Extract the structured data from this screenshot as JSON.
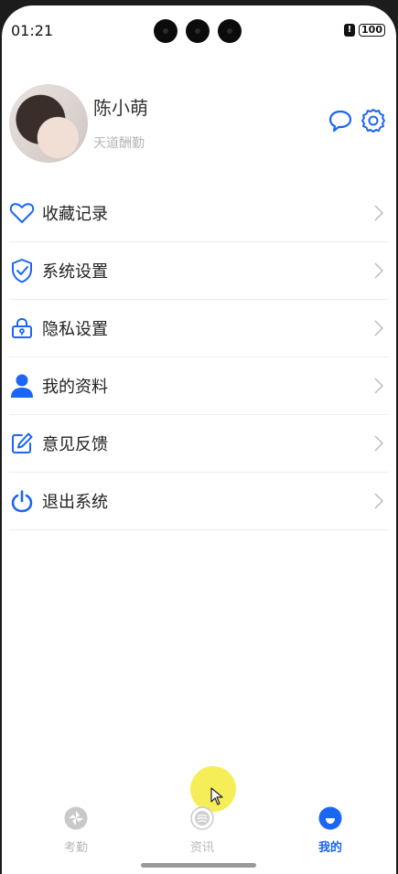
{
  "status_bar": {
    "time": "01:21",
    "battery": "100"
  },
  "profile": {
    "name": "陈小萌",
    "subtitle": "天道酬勤"
  },
  "menu": [
    {
      "label": "收藏记录",
      "icon": "heart-icon"
    },
    {
      "label": "系统设置",
      "icon": "shield-check-icon"
    },
    {
      "label": "隐私设置",
      "icon": "lock-icon"
    },
    {
      "label": "我的资料",
      "icon": "person-icon"
    },
    {
      "label": "意见反馈",
      "icon": "edit-icon"
    },
    {
      "label": "退出系统",
      "icon": "power-icon"
    }
  ],
  "tabs": [
    {
      "label": "考勤",
      "icon": "attendance-icon",
      "active": false
    },
    {
      "label": "资讯",
      "icon": "news-icon",
      "active": false
    },
    {
      "label": "我的",
      "icon": "profile-icon",
      "active": true
    }
  ],
  "colors": {
    "accent": "#1b66f5",
    "inactive": "#b8b8b8"
  }
}
